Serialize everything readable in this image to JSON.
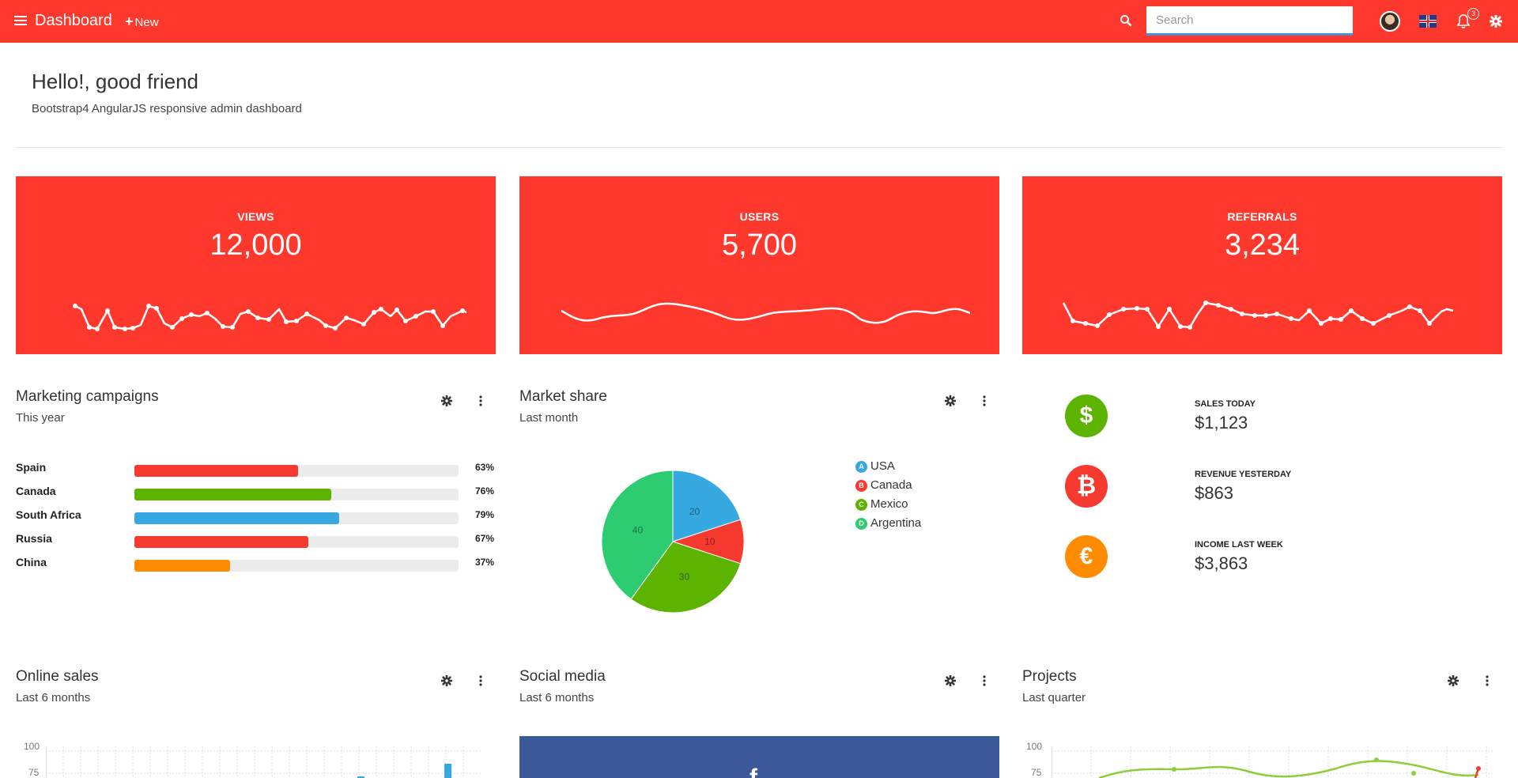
{
  "topbar": {
    "brand": "Dashboard",
    "new_label": "New",
    "search_placeholder": "Search",
    "notification_count": "3"
  },
  "hero": {
    "title": "Hello!, good friend",
    "subtitle": "Bootstrap4 AngularJS responsive admin dashboard"
  },
  "stats": [
    {
      "label": "VIEWS",
      "value": "12,000"
    },
    {
      "label": "USERS",
      "value": "5,700"
    },
    {
      "label": "REFERRALS",
      "value": "3,234"
    }
  ],
  "marketing": {
    "title": "Marketing campaigns",
    "subtitle": "This year",
    "rows": [
      {
        "country": "Spain",
        "percent": 63,
        "label": "63%",
        "color": "#f63a2f"
      },
      {
        "country": "Canada",
        "percent": 76,
        "label": "76%",
        "color": "#5cb300"
      },
      {
        "country": "South Africa",
        "percent": 79,
        "label": "79%",
        "color": "#36a9e1"
      },
      {
        "country": "Russia",
        "percent": 67,
        "label": "67%",
        "color": "#f63a2f"
      },
      {
        "country": "China",
        "percent": 37,
        "label": "37%",
        "color": "#ff8c00"
      }
    ]
  },
  "market_share": {
    "title": "Market share",
    "subtitle": "Last month",
    "legend": [
      {
        "letter": "A",
        "name": "USA",
        "color": "#36a9e1"
      },
      {
        "letter": "B",
        "name": "Canada",
        "color": "#f63a2f"
      },
      {
        "letter": "C",
        "name": "Mexico",
        "color": "#5cb300"
      },
      {
        "letter": "D",
        "name": "Argentina",
        "color": "#2ecc71"
      }
    ],
    "slice_labels": [
      "20",
      "10",
      "30",
      "40"
    ]
  },
  "sales": [
    {
      "symbol": "$",
      "label": "SALES TODAY",
      "value": "$1,123",
      "color": "#5cb300"
    },
    {
      "symbol": "₿",
      "label": "REVENUE YESTERDAY",
      "value": "$863",
      "color": "#f63a2f"
    },
    {
      "symbol": "€",
      "label": "INCOME LAST WEEK",
      "value": "$3,863",
      "color": "#ff8c00"
    }
  ],
  "online_sales": {
    "title": "Online sales",
    "subtitle": "Last 6 months",
    "ticks": [
      "100",
      "75"
    ]
  },
  "social_media": {
    "title": "Social media",
    "subtitle": "Last 6 months",
    "fb_symbol": "f"
  },
  "projects": {
    "title": "Projects",
    "subtitle": "Last quarter",
    "ticks": [
      "100",
      "75"
    ]
  },
  "chart_data": {
    "type": "pie",
    "categories": [
      "USA",
      "Canada",
      "Mexico",
      "Argentina"
    ],
    "values": [
      20,
      10,
      30,
      40
    ],
    "title": "Market share"
  }
}
